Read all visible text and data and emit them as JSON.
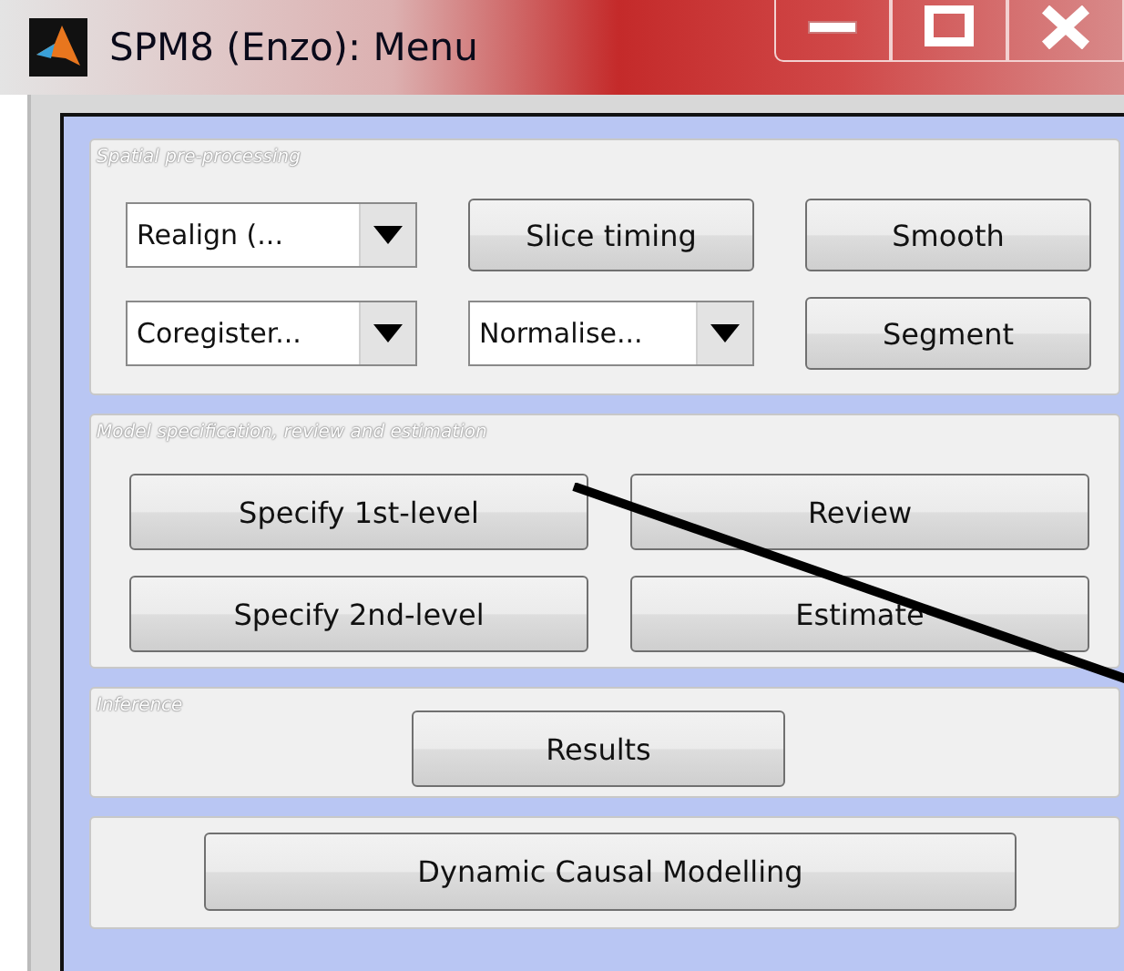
{
  "window": {
    "title": "SPM8 (Enzo): Menu"
  },
  "panels": [
    {
      "title": "Spatial pre-processing",
      "rows": [
        [
          {
            "kind": "dropdown",
            "label": "Realign (..."
          },
          {
            "kind": "button",
            "label": "Slice timing"
          },
          {
            "kind": "button",
            "label": "Smooth"
          }
        ],
        [
          {
            "kind": "dropdown",
            "label": "Coregister..."
          },
          {
            "kind": "dropdown",
            "label": "Normalise..."
          },
          {
            "kind": "button",
            "label": "Segment"
          }
        ]
      ]
    },
    {
      "title": "Model specification, review and estimation",
      "rows": [
        [
          {
            "kind": "button",
            "label": "Specify 1st-level"
          },
          {
            "kind": "button",
            "label": "Review"
          }
        ],
        [
          {
            "kind": "button",
            "label": "Specify 2nd-level"
          },
          {
            "kind": "button",
            "label": "Estimate"
          }
        ]
      ]
    },
    {
      "title": "Inference",
      "rows": [
        [
          {
            "kind": "button",
            "label": "Results"
          }
        ]
      ]
    },
    {
      "rows": [
        [
          {
            "kind": "button",
            "label": "Dynamic Causal Modelling"
          }
        ]
      ]
    }
  ]
}
